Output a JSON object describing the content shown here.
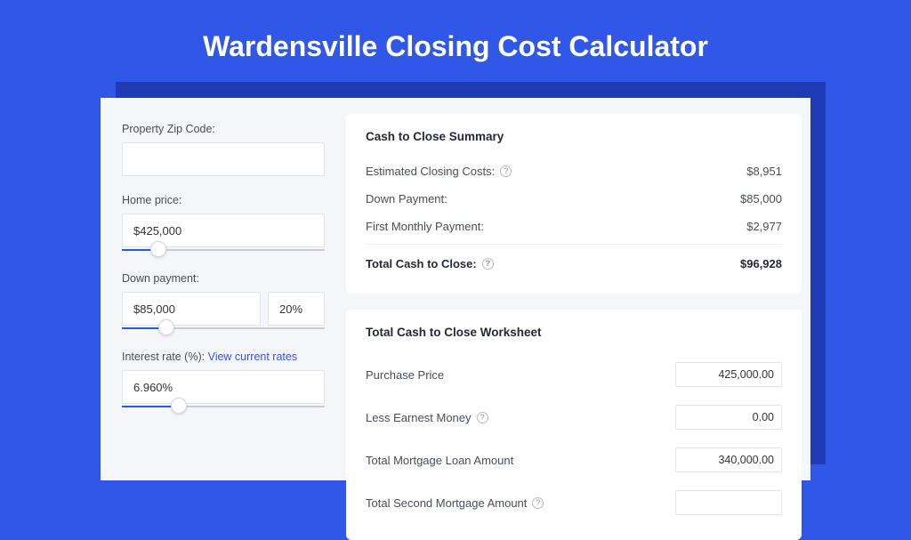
{
  "colors": {
    "accent": "#3057e8",
    "shadow": "#1f3bb5",
    "panel_bg": "#f5f6fa"
  },
  "title": "Wardensville Closing Cost Calculator",
  "left": {
    "zip_label": "Property Zip Code:",
    "zip_value": "",
    "home_price_label": "Home price:",
    "home_price_value": "$425,000",
    "home_price_slider_pct": 18,
    "down_payment_label": "Down payment:",
    "down_payment_value": "$85,000",
    "down_payment_pct": "20%",
    "down_payment_slider_pct": 22,
    "interest_label": "Interest rate (%):",
    "interest_link": "View current rates",
    "interest_value": "6.960%",
    "interest_slider_pct": 28
  },
  "summary": {
    "heading": "Cash to Close Summary",
    "rows": [
      {
        "label": "Estimated Closing Costs:",
        "help": true,
        "value": "$8,951"
      },
      {
        "label": "Down Payment:",
        "help": false,
        "value": "$85,000"
      },
      {
        "label": "First Monthly Payment:",
        "help": false,
        "value": "$2,977"
      }
    ],
    "total_label": "Total Cash to Close:",
    "total_help": true,
    "total_value": "$96,928"
  },
  "worksheet": {
    "heading": "Total Cash to Close Worksheet",
    "rows": [
      {
        "label": "Purchase Price",
        "help": false,
        "value": "425,000.00"
      },
      {
        "label": "Less Earnest Money",
        "help": true,
        "value": "0.00"
      },
      {
        "label": "Total Mortgage Loan Amount",
        "help": false,
        "value": "340,000.00"
      },
      {
        "label": "Total Second Mortgage Amount",
        "help": true,
        "value": ""
      }
    ]
  }
}
